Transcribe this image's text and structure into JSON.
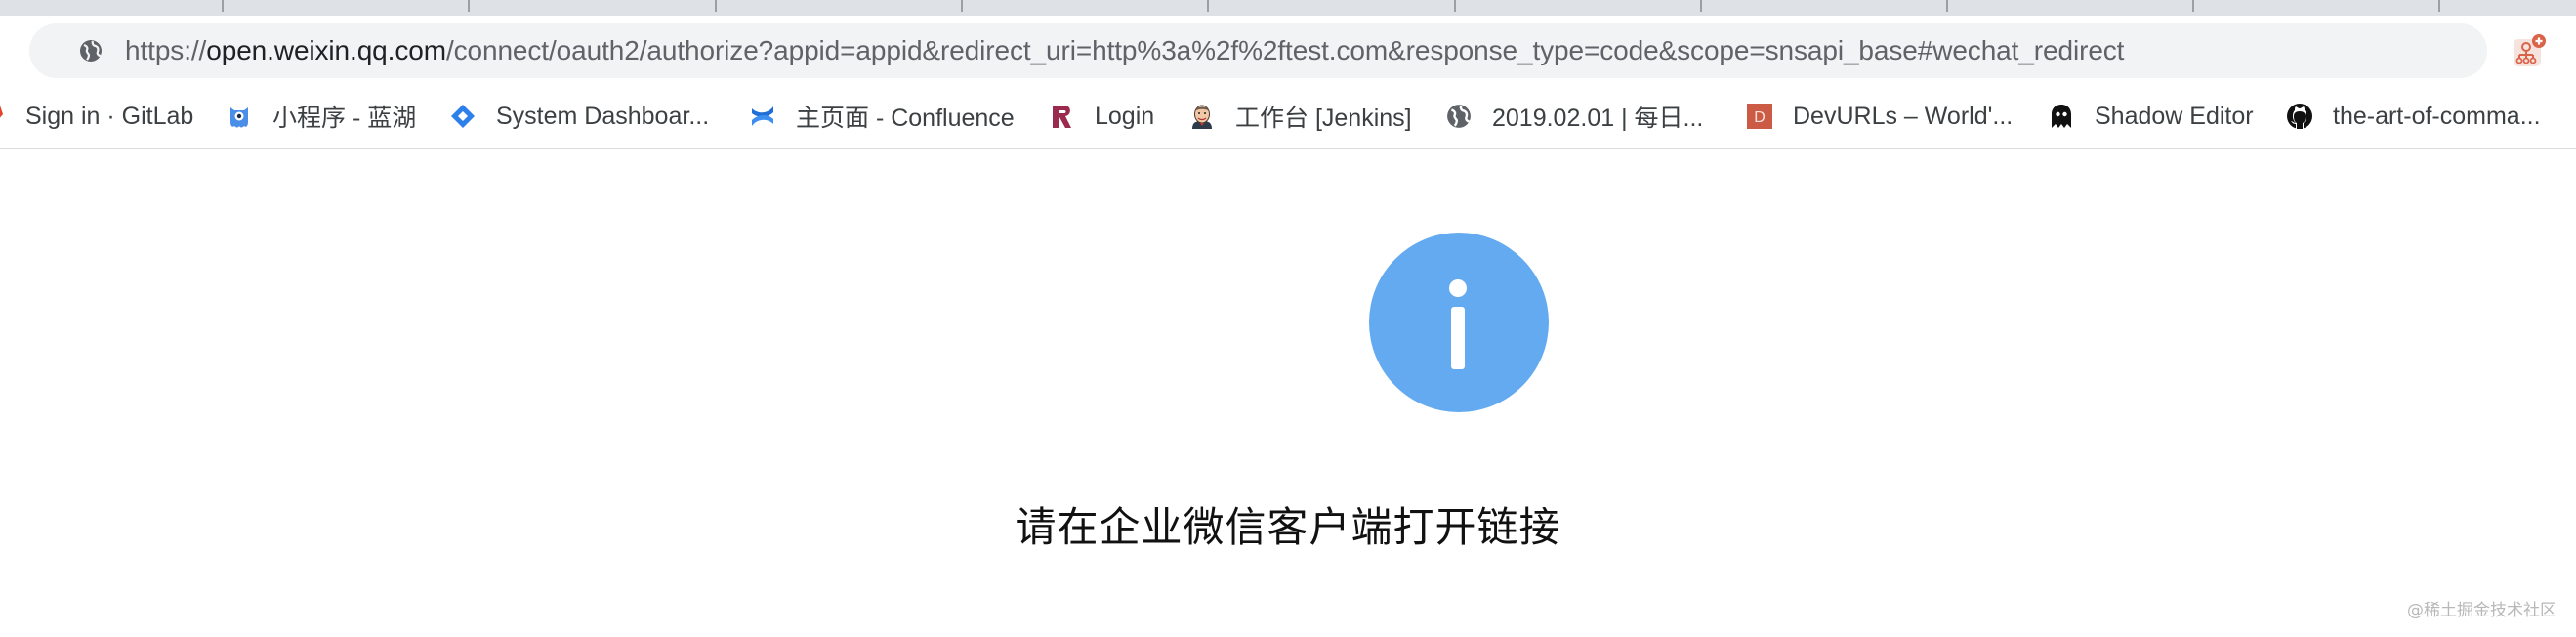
{
  "browser": {
    "address_bar": {
      "url_scheme": "https://",
      "url_host": "open.weixin.qq.com",
      "url_rest": "/connect/oauth2/authorize?appid=appid&redirect_uri=http%3a%2f%2ftest.com&response_type=code&scope=snsapi_base#wechat_redirect",
      "site_icon": "globe-icon"
    },
    "extension": {
      "icon": "sitemap-plus-icon",
      "color": "#d9644a"
    },
    "bookmarks": [
      {
        "label": "Sign in · GitLab",
        "icon": "gitlab-icon"
      },
      {
        "label": "小程序 - 蓝湖",
        "icon": "lanhu-icon"
      },
      {
        "label": "System Dashboar...",
        "icon": "jira-icon"
      },
      {
        "label": "主页面 - Confluence",
        "icon": "confluence-icon"
      },
      {
        "label": "Login",
        "icon": "r-logo-icon"
      },
      {
        "label": "工作台 [Jenkins]",
        "icon": "jenkins-icon"
      },
      {
        "label": "2019.02.01 | 每日...",
        "icon": "globe-icon"
      },
      {
        "label": "DevURLs – World'...",
        "icon": "devurls-icon",
        "icon_letter": "D"
      },
      {
        "label": "Shadow Editor",
        "icon": "ghost-icon"
      },
      {
        "label": "the-art-of-comma...",
        "icon": "github-icon"
      }
    ]
  },
  "page": {
    "icon": "info-icon",
    "icon_color": "#64aaf0",
    "message": "请在企业微信客户端打开链接"
  },
  "watermark": "@稀土掘金技术社区"
}
